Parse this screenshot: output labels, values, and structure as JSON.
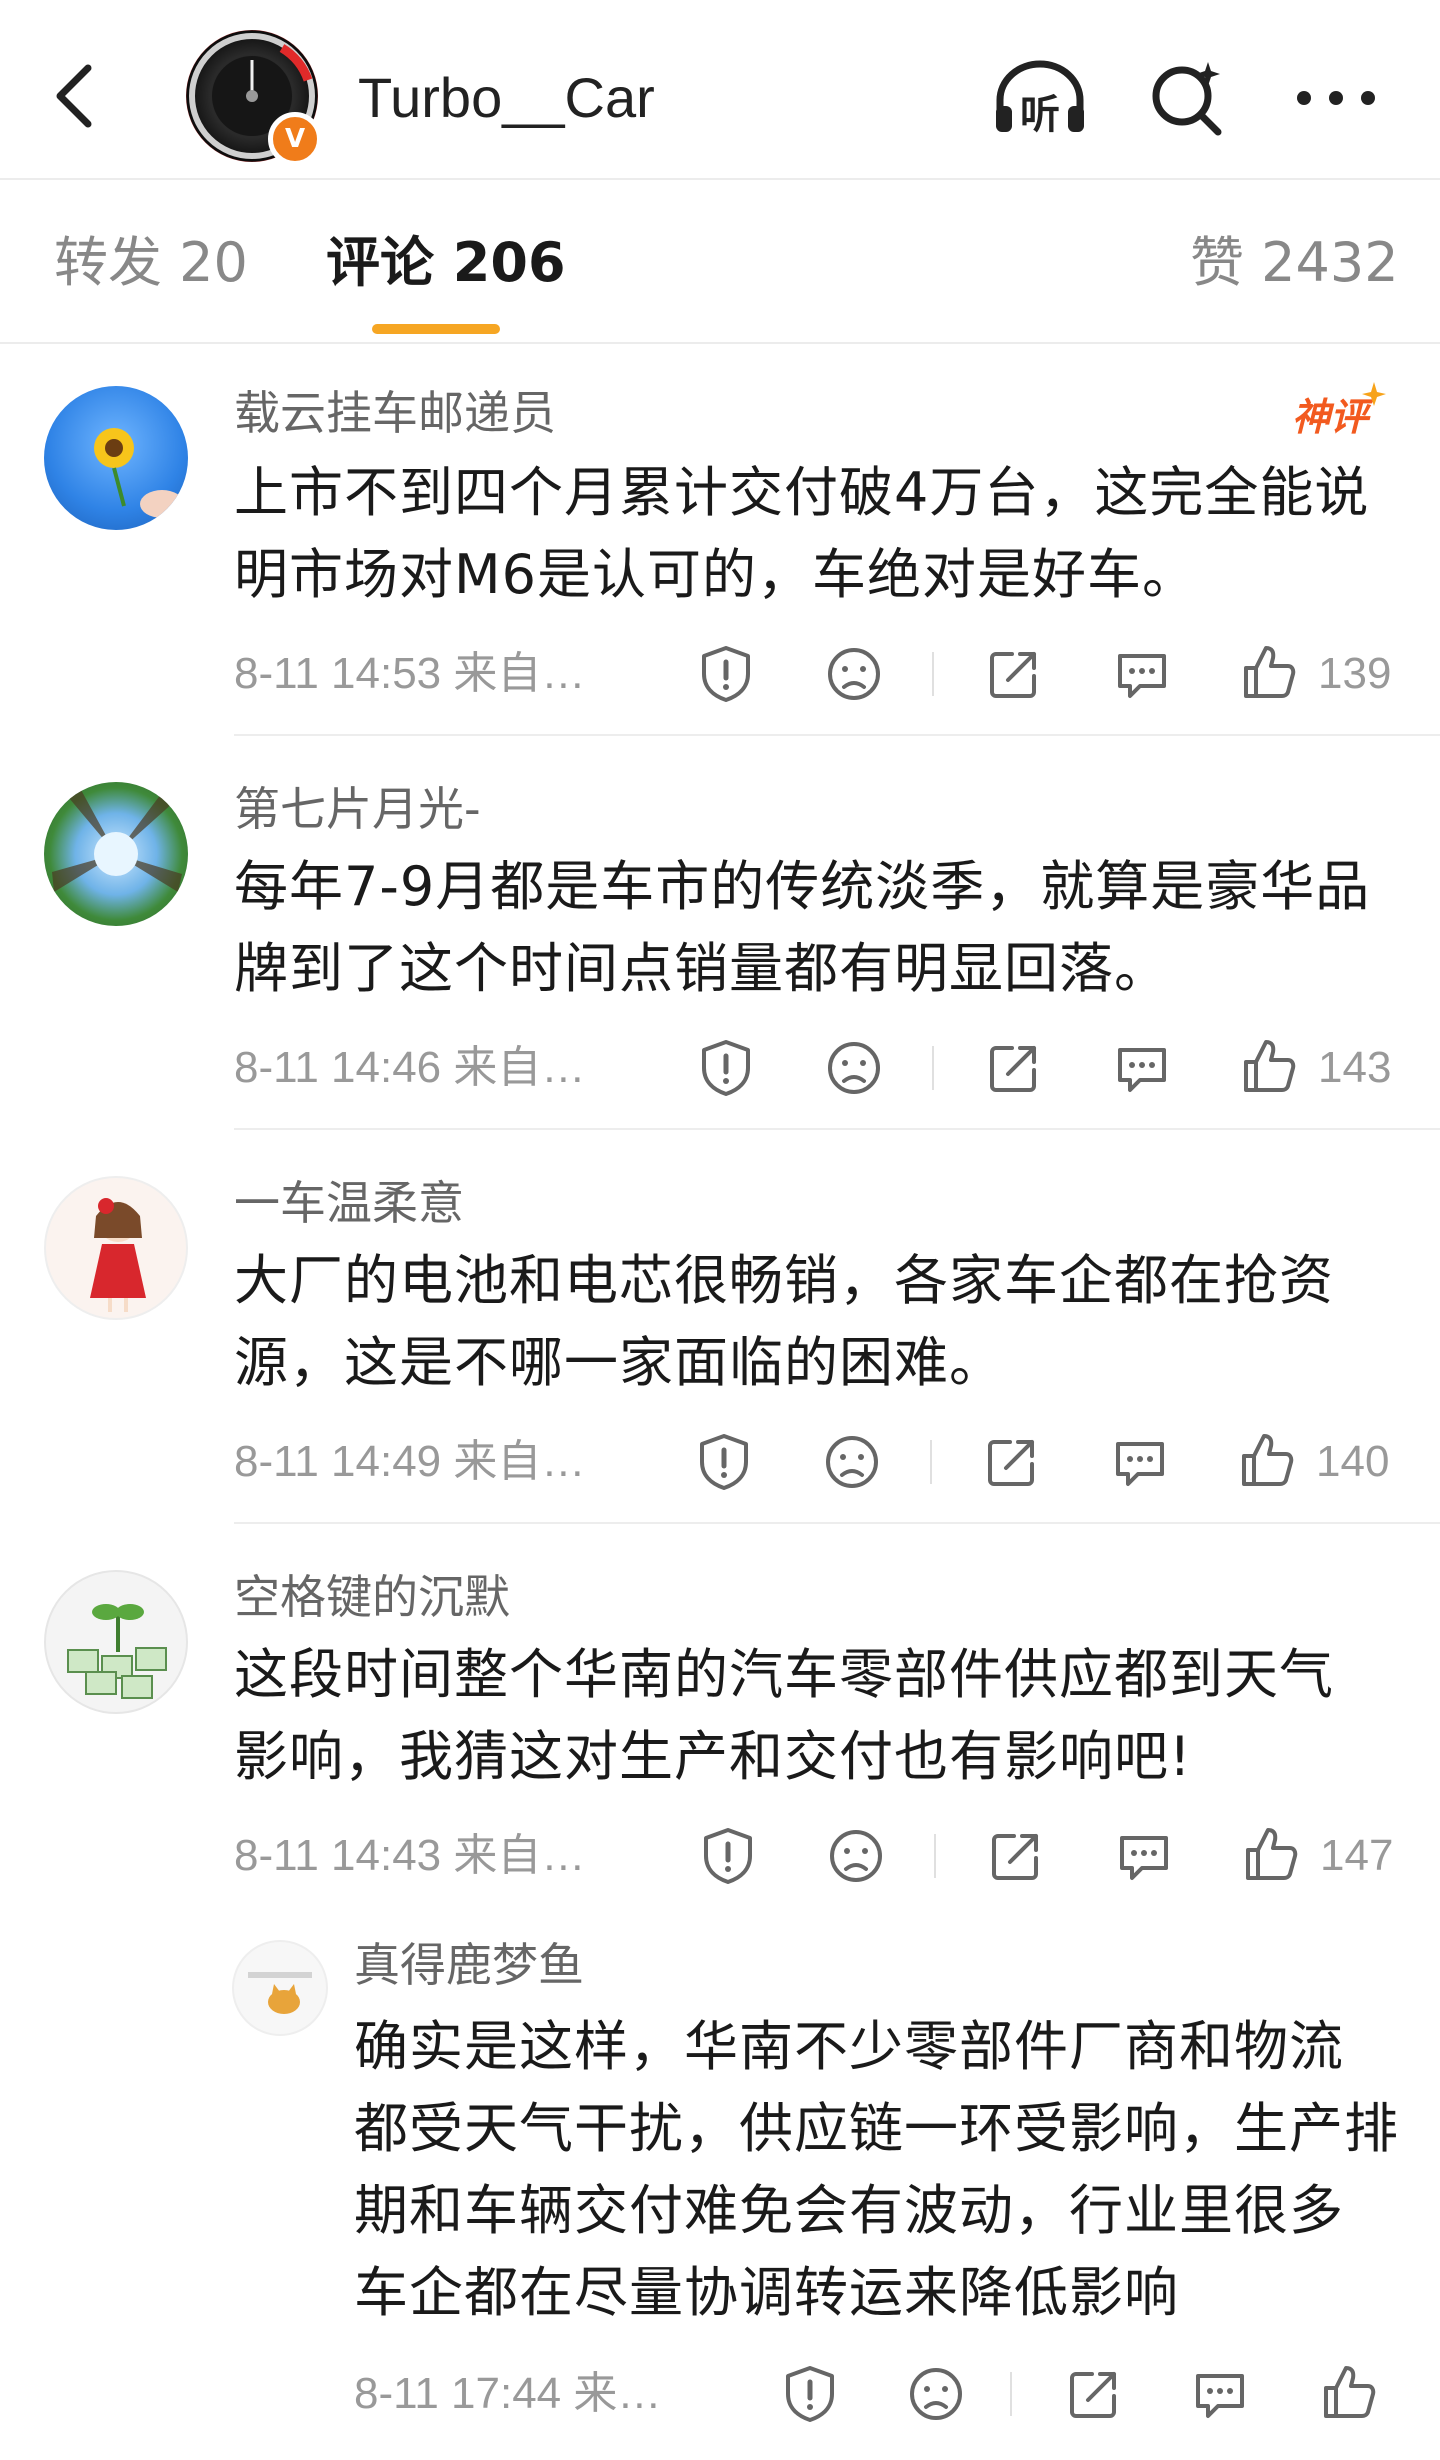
{
  "header": {
    "title": "Turbo__Car",
    "back_icon": "back-arrow-icon",
    "listen_icon": "headphone-listen-icon",
    "listen_label": "听",
    "search_icon": "search-sparkle-icon",
    "more_icon": "more-dots-icon",
    "verified_mark": "V"
  },
  "tabs": {
    "repost": "转发 20",
    "comments": "评论 206",
    "likes": "赞 2432"
  },
  "colors": {
    "accent": "#f6a623",
    "badge": "#f07c1a",
    "hot": "#f25a1f"
  },
  "comments": [
    {
      "name": "载云挂车邮递员",
      "badge": "神评",
      "text_line1": "上市不到四个月累计交付破4万台，这完全能说",
      "text_line2": "明市场对M6是认可的，车绝对是好车。",
      "meta": "8-11 14:53 来自…",
      "likes": "139"
    },
    {
      "name": "第七片月光-",
      "text_line1": "每年7-9月都是车市的传统淡季，就算是豪华品",
      "text_line2": "牌到了这个时间点销量都有明显回落。",
      "meta": "8-11 14:46 来自…",
      "likes": "143"
    },
    {
      "name": "一车温柔意",
      "text_line1": "大厂的电池和电芯很畅销，各家车企都在抢资",
      "text_line2": "源，这是不哪一家面临的困难。",
      "meta": "8-11 14:49 来自…",
      "likes": "140"
    },
    {
      "name": "空格键的沉默",
      "text_line1": "这段时间整个华南的汽车零部件供应都到天气",
      "text_line2": "影响，我猜这对生产和交付也有影响吧!",
      "meta": "8-11 14:43 来自…",
      "likes": "147"
    }
  ],
  "reply": {
    "name": "真得鹿梦鱼",
    "text_line1": "确实是这样，华南不少零部件厂商和物流",
    "text_line2": "都受天气干扰，供应链一环受影响，生产排",
    "text_line3": "期和车辆交付难免会有波动，行业里很多",
    "text_line4": "车企都在尽量协调转运来降低影响",
    "meta": "8-11 17:44 来…"
  }
}
